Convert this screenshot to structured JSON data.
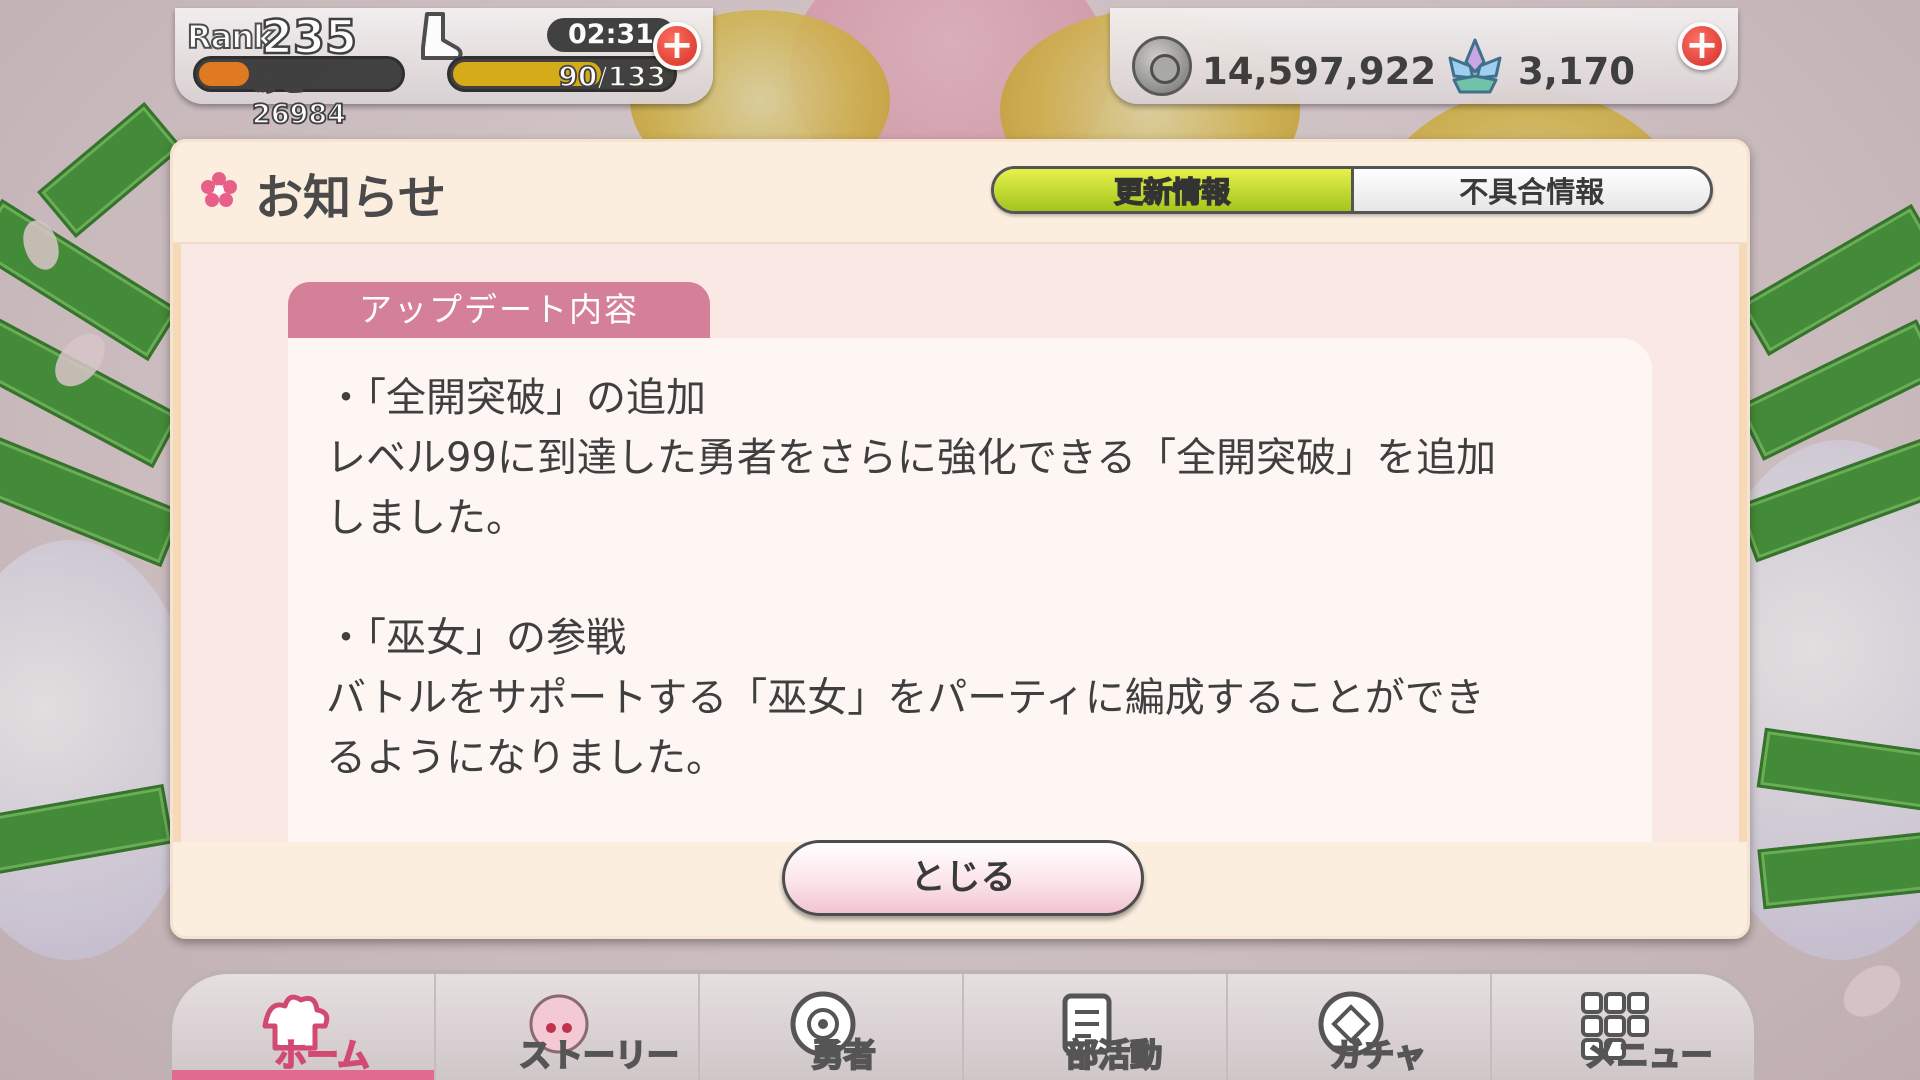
{
  "hud": {
    "rank_label": "Rank",
    "rank_value": "235",
    "exp_remaining": "あと 26984",
    "stamina_timer": "02:31",
    "stamina": "90/133",
    "stamina_fraction": 0.677,
    "coins": "14,597,922",
    "gems": "3,170"
  },
  "dialog": {
    "title": "お知らせ",
    "tabs": [
      {
        "label": "更新情報",
        "active": true
      },
      {
        "label": "不具合情報",
        "active": false
      }
    ],
    "section_tag": "アップデート内容",
    "notice_text": "・「全開突破」の追加\nレベル99に到達した勇者をさらに強化できる「全開突破」を追加\nしました。\n\n・「巫女」の参戦\nバトルをサポートする「巫女」をパーティに編成することができ\nるようになりました。",
    "close_label": "とじる"
  },
  "nav": {
    "items": [
      {
        "label": "ホーム",
        "icon": "home-icon",
        "active": true
      },
      {
        "label": "ストーリー",
        "icon": "story-icon",
        "active": false
      },
      {
        "label": "勇者",
        "icon": "hero-icon",
        "active": false
      },
      {
        "label": "部活動",
        "icon": "club-icon",
        "active": false
      },
      {
        "label": "ガチャ",
        "icon": "gacha-icon",
        "active": false
      },
      {
        "label": "メニュー",
        "icon": "menu-grid-icon",
        "active": false
      }
    ]
  },
  "colors": {
    "accent_pink": "#d48099",
    "tab_active": "#bcd632",
    "plus_red": "#d42a22",
    "stripe_green": "#3f9a34"
  }
}
